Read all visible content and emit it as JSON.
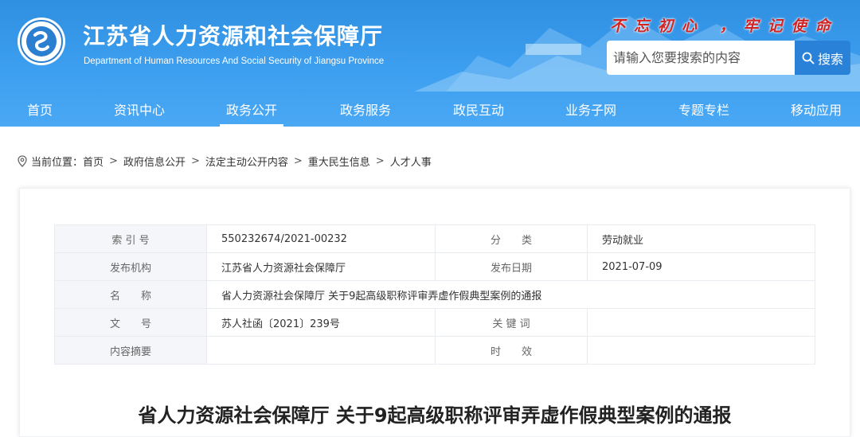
{
  "header": {
    "title": "江苏省人力资源和社会保障厅",
    "subtitle": "Department of Human Resources And Social Security of Jiangsu Province",
    "slogan": "不忘初心 ，牢记使命",
    "search": {
      "placeholder": "请输入您要搜索的内容",
      "button_label": "搜索"
    }
  },
  "nav": {
    "items": [
      {
        "label": "首页"
      },
      {
        "label": "资讯中心"
      },
      {
        "label": "政务公开"
      },
      {
        "label": "政务服务"
      },
      {
        "label": "政民互动"
      },
      {
        "label": "业务子网"
      },
      {
        "label": "专题专栏"
      },
      {
        "label": "移动应用"
      }
    ],
    "active_index": 2
  },
  "breadcrumb": {
    "prefix": "当前位置：",
    "items": [
      "首页",
      "政府信息公开",
      "法定主动公开内容",
      "重大民生信息",
      "人才人事"
    ]
  },
  "info": {
    "index_label": "索 引 号",
    "index_value": "550232674/2021-00232",
    "category_label": "分　　类",
    "category_value": "劳动就业",
    "publisher_label": "发布机构",
    "publisher_value": "江苏省人力资源社会保障厅",
    "date_label": "发布日期",
    "date_value": "2021-07-09",
    "name_label": "名　　称",
    "name_value": "省人力资源社会保障厅 关于9起高级职称评审弄虚作假典型案例的通报",
    "doc_no_label": "文　　号",
    "doc_no_value": "苏人社函〔2021〕239号",
    "keywords_label": "关 键 词",
    "keywords_value": "",
    "summary_label": "内容摘要",
    "summary_value": "",
    "validity_label": "时　　效",
    "validity_value": ""
  },
  "document": {
    "title": "省人力资源社会保障厅 关于9起高级职称评审弄虚作假典型案例的通报"
  },
  "colors": {
    "header_blue": "#3d9ff0",
    "search_button": "#2a82d8",
    "slogan_red": "#d32222"
  },
  "icons": {
    "logo": "hrss-logo",
    "search": "search-icon",
    "location": "location-pin-icon"
  }
}
